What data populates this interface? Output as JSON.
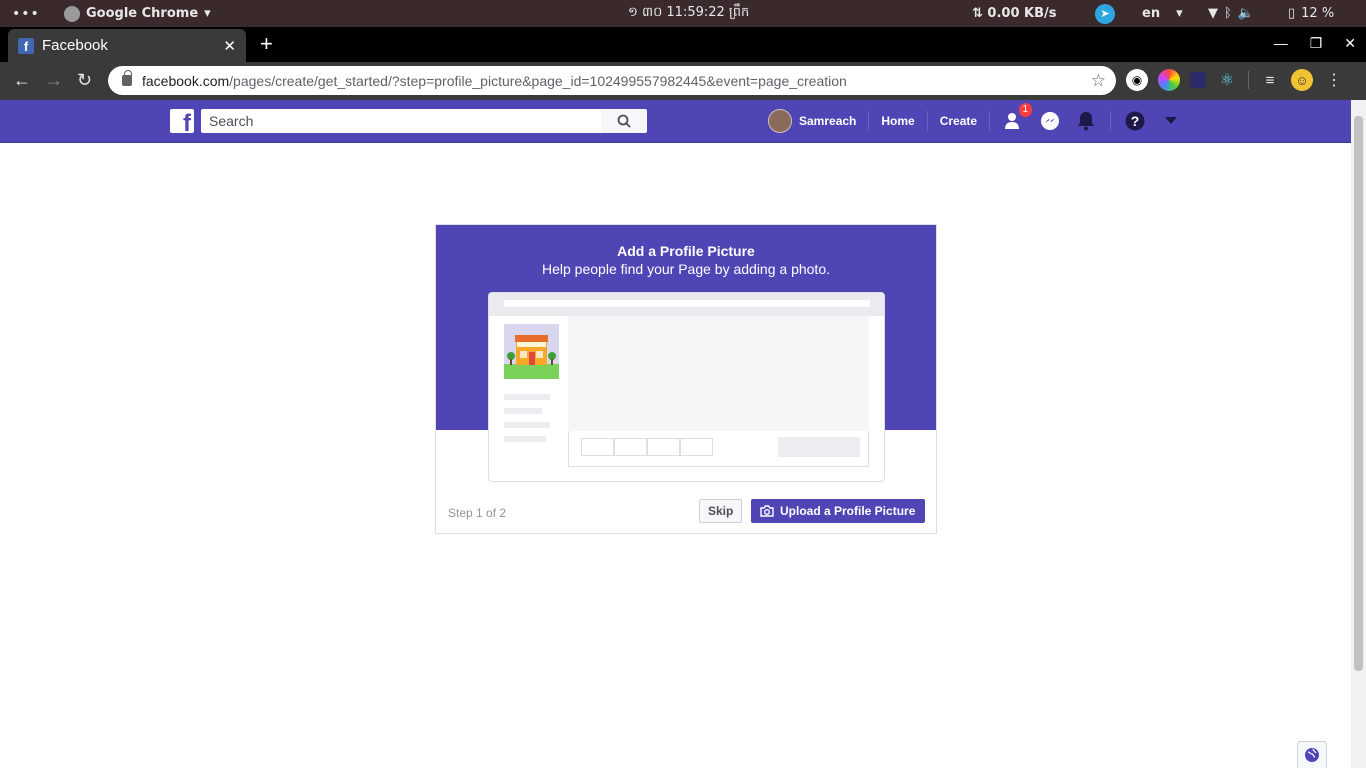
{
  "os": {
    "app_name": "Google Chrome",
    "clock": "១ ៣០ 11:59:22 ព្រឹក",
    "net_speed": "⇅ 0.00 KB/s",
    "lang": "en",
    "battery": "12 %"
  },
  "browser": {
    "tab_title": "Facebook",
    "url_host": "facebook.com",
    "url_path": "/pages/create/get_started/?step=profile_picture&page_id=102499557982445&event=page_creation"
  },
  "fb": {
    "search_placeholder": "Search",
    "user_name": "Samreach",
    "home_label": "Home",
    "create_label": "Create",
    "friend_requests_count": "1",
    "brand_color": "#4f45b5"
  },
  "dialog": {
    "title": "Add a Profile Picture",
    "subtitle": "Help people find your Page by adding a photo.",
    "step_text": "Step 1 of 2",
    "skip_label": "Skip",
    "upload_label": "Upload a Profile Picture"
  }
}
